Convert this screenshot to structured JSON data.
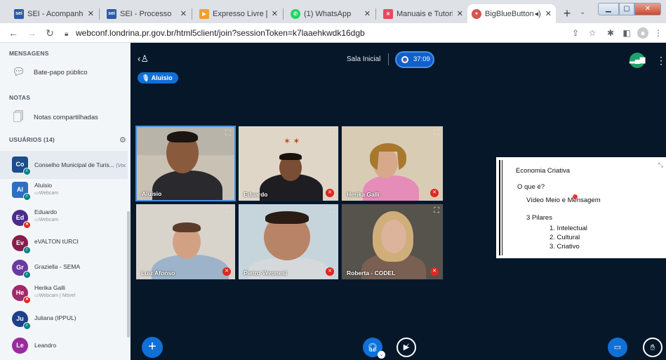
{
  "browser": {
    "tabs": [
      {
        "title": "SEI - Acompanhame",
        "favicon": "sei-icon",
        "favicon_color": "#2b5ba8",
        "active": false
      },
      {
        "title": "SEI - Processo",
        "favicon": "sei-icon",
        "favicon_color": "#2b5ba8",
        "active": false
      },
      {
        "title": "Expresso Livre [Expr",
        "favicon": "expresso-icon",
        "favicon_color": "#f0a030",
        "active": false
      },
      {
        "title": "(1) WhatsApp",
        "favicon": "whatsapp-icon",
        "favicon_color": "#25d366",
        "active": false
      },
      {
        "title": "Manuais e Tutoriais",
        "favicon": "manuais-icon",
        "favicon_color": "#e84a5f",
        "active": false
      },
      {
        "title": "BigBlueButton - ",
        "favicon": "bigbluebutton-icon",
        "favicon_color": "#d9534f",
        "active": true
      }
    ],
    "url": "webconf.londrina.pr.gov.br/html5client/join?sessionToken=k7laaehkwdk16dgb"
  },
  "sidebar": {
    "messages_heading": "MENSAGENS",
    "public_chat": "Bate-papo público",
    "notes_heading": "NOTAS",
    "shared_notes": "Notas compartilhadas",
    "users_heading": "USUÁRIOS (14)",
    "users": [
      {
        "initials": "Co",
        "name": "Conselho Municipal de Turis...",
        "you": "(Você)",
        "sub": "",
        "color": "#1a4d8c",
        "square": true,
        "badge": "audio",
        "me": true
      },
      {
        "initials": "Al",
        "name": "Aluisio",
        "you": "",
        "sub": "Webcam",
        "color": "#2f6fc2",
        "square": true,
        "badge": "audio",
        "me": false
      },
      {
        "initials": "Ed",
        "name": "Eduardo",
        "you": "",
        "sub": "Webcam",
        "color": "#4c2c8a",
        "square": false,
        "badge": "muted",
        "me": false
      },
      {
        "initials": "Ev",
        "name": "eVALTON tURCI",
        "you": "",
        "sub": "",
        "color": "#8a1c4d",
        "square": false,
        "badge": "audio",
        "me": false
      },
      {
        "initials": "Gr",
        "name": "Graziella - SEMA",
        "you": "",
        "sub": "",
        "color": "#6a3aa0",
        "square": false,
        "badge": "audio",
        "me": false
      },
      {
        "initials": "He",
        "name": "Herika Galli",
        "you": "",
        "sub": "Webcam | Móvel",
        "color": "#a02a6a",
        "square": false,
        "badge": "muted",
        "me": false
      },
      {
        "initials": "Ju",
        "name": "Juliana (IPPUL)",
        "you": "",
        "sub": "",
        "color": "#1e3f8a",
        "square": false,
        "badge": "audio",
        "me": false
      },
      {
        "initials": "Le",
        "name": "Leandro",
        "you": "",
        "sub": "",
        "color": "#9a2aa0",
        "square": false,
        "badge": "",
        "me": false
      }
    ]
  },
  "main": {
    "talking": "Aluisio",
    "room_title": "Sala Inicial",
    "timer": "37:09",
    "videos": [
      {
        "label": "Aluisio",
        "bg": "#c9c2b4",
        "skin": "#8a5a3c",
        "shirt": "#2a2a2e",
        "muted": false,
        "speaking": true
      },
      {
        "label": "Eduardo",
        "bg": "#e0d6c8",
        "skin": "#7a4e34",
        "shirt": "#1e1e22",
        "muted": true,
        "speaking": false
      },
      {
        "label": "Herika Galli",
        "bg": "#d9ccb5",
        "skin": "#d7a98a",
        "shirt": "#e58cb8",
        "muted": true,
        "speaking": false
      },
      {
        "label": "Luiz Afonso",
        "bg": "#d8d4cc",
        "skin": "#d2a184",
        "shirt": "#9cb3c9",
        "muted": true,
        "speaking": false
      },
      {
        "label": "Pietro Veronesi",
        "bg": "#c6d4dc",
        "skin": "#b88467",
        "shirt": "#d6d9dc",
        "muted": true,
        "speaking": false
      },
      {
        "label": "Roberta - CODEL",
        "bg": "#56524c",
        "skin": "#dcb49c",
        "shirt": "#7a6052",
        "muted": true,
        "speaking": false
      }
    ],
    "slide": {
      "line1": "Economia Criativa",
      "line2": "O que é?",
      "line3": "Vídeo Meio e Mensagem",
      "line4": "3 Pilares",
      "items": [
        "1.  Intelectual",
        "2.  Cultural",
        "3.  Criativo"
      ]
    }
  }
}
